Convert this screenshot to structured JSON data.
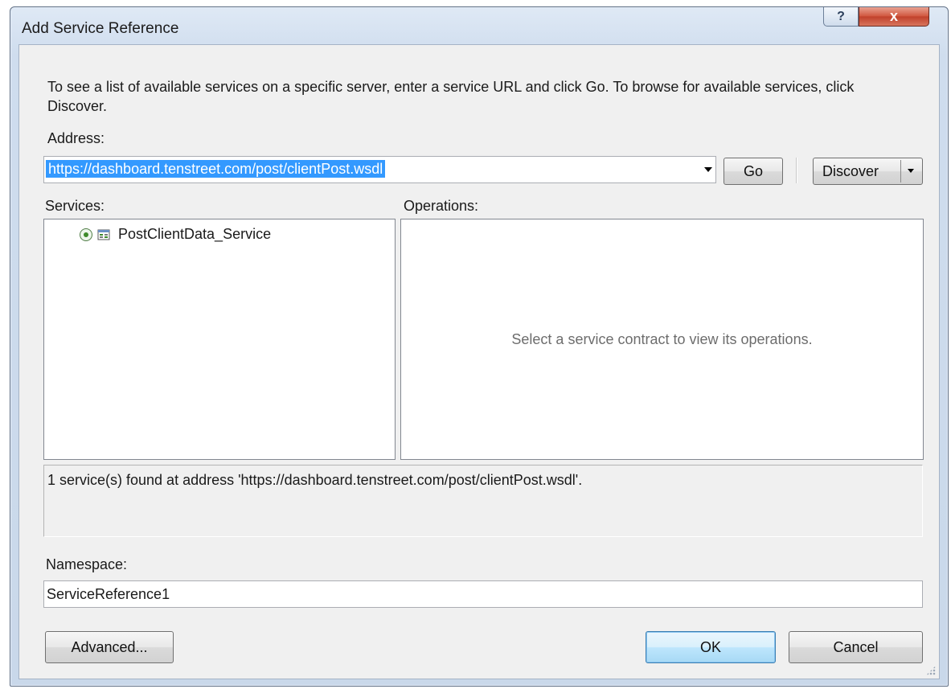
{
  "window": {
    "title": "Add Service Reference",
    "help_glyph": "?",
    "close_glyph": "x"
  },
  "instructions": "To see a list of available services on a specific server, enter a service URL and click Go. To browse for available services, click Discover.",
  "address": {
    "label": "Address:",
    "value": "https://dashboard.tenstreet.com/post/clientPost.wsdl",
    "go_label": "Go",
    "discover_label": "Discover"
  },
  "services": {
    "label": "Services:",
    "items": [
      {
        "label": "PostClientData_Service",
        "icon": "service-icon",
        "selected": true
      }
    ]
  },
  "operations": {
    "label": "Operations:",
    "placeholder": "Select a service contract to view its operations."
  },
  "status": "1 service(s) found at address 'https://dashboard.tenstreet.com/post/clientPost.wsdl'.",
  "namespace": {
    "label": "Namespace:",
    "value": "ServiceReference1"
  },
  "footer": {
    "advanced_label": "Advanced...",
    "ok_label": "OK",
    "cancel_label": "Cancel"
  },
  "colors": {
    "selection": "#3399ff",
    "close_button": "#c0402a",
    "dialog_face": "#f0f0f0",
    "frame": "#cfddee"
  }
}
